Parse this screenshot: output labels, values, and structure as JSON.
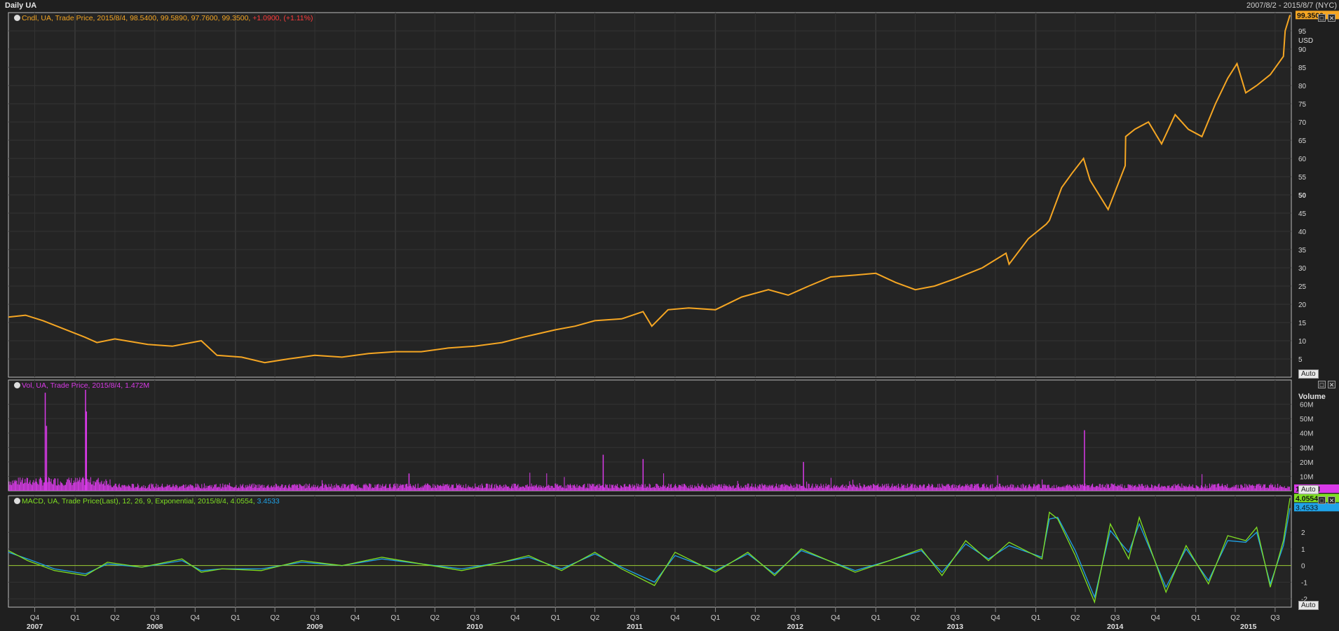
{
  "header": {
    "title": "Daily UA",
    "range": "2007/8/2 - 2015/8/7 (NYC)"
  },
  "price_panel": {
    "legend_prefix": "Cndl, UA, Trade Price, 2015/8/4, 98.5400, 99.5890, 97.7600, 99.3500,",
    "legend_change": "+1.0900, (+1.11%)",
    "currency": "USD",
    "last_value": "99.3500",
    "auto_label": "Auto",
    "color": "#f5a623",
    "change_color": "#ff3b3b"
  },
  "volume_panel": {
    "legend": "Vol, UA, Trade Price, 2015/8/4, 1.472M",
    "axis_title": "Volume",
    "last_value": "1.472M",
    "auto_label": "Auto",
    "color": "#d93ae8"
  },
  "macd_panel": {
    "legend_prefix": "MACD, UA, Trade Price(Last), 12, 26, 9, Exponential, 2015/8/4, 4.0554,",
    "legend_signal": "3.4533",
    "macd_last": "4.0554",
    "signal_last": "3.4533",
    "auto_label": "Auto",
    "macd_color": "#7fe022",
    "signal_color": "#1fa3e8"
  },
  "chart_data": [
    {
      "type": "line",
      "ylim": [
        0,
        100
      ],
      "y_ticks": [
        5,
        10,
        15,
        20,
        25,
        30,
        35,
        40,
        45,
        50,
        55,
        60,
        65,
        70,
        75,
        80,
        85,
        90,
        95
      ],
      "x": [
        "2007-08-02",
        "2007-09-10",
        "2007-10-20",
        "2007-12-01",
        "2008-01-23",
        "2008-02-20",
        "2008-04-01",
        "2008-06-15",
        "2008-08-10",
        "2008-10-15",
        "2008-11-20",
        "2009-01-15",
        "2009-03-09",
        "2009-05-01",
        "2009-07-01",
        "2009-09-01",
        "2009-11-01",
        "2010-01-01",
        "2010-03-01",
        "2010-05-01",
        "2010-07-01",
        "2010-09-01",
        "2010-10-20",
        "2011-01-01",
        "2011-02-15",
        "2011-04-01",
        "2011-06-01",
        "2011-07-20",
        "2011-08-09",
        "2011-09-15",
        "2011-11-01",
        "2012-01-01",
        "2012-03-01",
        "2012-05-01",
        "2012-06-15",
        "2012-08-01",
        "2012-09-20",
        "2012-11-15",
        "2013-01-01",
        "2013-02-15",
        "2013-04-01",
        "2013-05-15",
        "2013-07-01",
        "2013-09-01",
        "2013-10-25",
        "2013-11-01",
        "2013-12-15",
        "2014-01-25",
        "2014-02-01",
        "2014-03-01",
        "2014-03-25",
        "2014-04-20",
        "2014-05-05",
        "2014-06-15",
        "2014-07-24",
        "2014-07-25",
        "2014-08-15",
        "2014-09-15",
        "2014-10-15",
        "2014-11-15",
        "2014-12-15",
        "2015-01-15",
        "2015-02-15",
        "2015-03-15",
        "2015-04-05",
        "2015-04-25",
        "2015-05-20",
        "2015-06-20",
        "2015-07-20",
        "2015-07-24",
        "2015-08-04"
      ],
      "series": [
        {
          "values": [
            16.5,
            17,
            15.5,
            13.5,
            11,
            9.5,
            10.5,
            9,
            8.5,
            10,
            6,
            5.5,
            4,
            5,
            6,
            5.5,
            6.5,
            7,
            7,
            8,
            8.5,
            9.5,
            11,
            13,
            14,
            15.5,
            16,
            18,
            14,
            18.5,
            19,
            18.5,
            22,
            24,
            22.5,
            25,
            27.5,
            28,
            28.5,
            26,
            24,
            25,
            27,
            30,
            34,
            31,
            38,
            42,
            43,
            52,
            56,
            60,
            54,
            46,
            58,
            66,
            68,
            70,
            64,
            72,
            68,
            66,
            75,
            82,
            86,
            78,
            80,
            83,
            88,
            95,
            99.35
          ]
        }
      ]
    },
    {
      "type": "bar",
      "ylim": [
        0,
        70
      ],
      "y_ticks_labels": [
        "10M",
        "20M",
        "30M",
        "40M",
        "50M",
        "60M"
      ],
      "y_ticks": [
        10,
        20,
        30,
        40,
        50,
        60
      ],
      "unit": "M",
      "x": [
        "2007-10-25",
        "2007-10-28",
        "2008-01-25",
        "2008-01-27",
        "2010-02-01",
        "2011-04-20",
        "2014-04-22",
        "2011-07-20",
        "2012-07-20"
      ],
      "values": [
        68,
        45,
        70,
        55,
        12,
        25,
        42,
        22,
        20
      ],
      "last_value": 1.472
    },
    {
      "type": "line",
      "ylim": [
        -2.5,
        4.2
      ],
      "y_ticks": [
        -2,
        -1,
        0,
        1,
        2
      ],
      "x": [
        "2007-08-02",
        "2007-09-15",
        "2007-11-15",
        "2008-01-25",
        "2008-03-15",
        "2008-06-01",
        "2008-09-01",
        "2008-10-15",
        "2008-12-01",
        "2009-03-01",
        "2009-06-01",
        "2009-09-01",
        "2009-12-01",
        "2010-03-01",
        "2010-06-01",
        "2010-09-01",
        "2010-11-01",
        "2011-01-15",
        "2011-04-01",
        "2011-06-01",
        "2011-08-15",
        "2011-10-01",
        "2012-01-01",
        "2012-03-15",
        "2012-05-15",
        "2012-07-15",
        "2012-09-15",
        "2012-11-15",
        "2013-02-01",
        "2013-04-15",
        "2013-06-01",
        "2013-07-25",
        "2013-09-15",
        "2013-11-01",
        "2014-01-15",
        "2014-02-01",
        "2014-02-20",
        "2014-04-01",
        "2014-05-15",
        "2014-06-20",
        "2014-08-01",
        "2014-08-25",
        "2014-10-25",
        "2014-12-10",
        "2015-01-30",
        "2015-03-15",
        "2015-04-25",
        "2015-05-20",
        "2015-06-20",
        "2015-07-20",
        "2015-08-04"
      ],
      "series": [
        {
          "name": "MACD",
          "values": [
            0.9,
            0.3,
            -0.3,
            -0.6,
            0.2,
            -0.1,
            0.4,
            -0.4,
            -0.2,
            -0.3,
            0.3,
            0,
            0.5,
            0.1,
            -0.3,
            0.2,
            0.6,
            -0.3,
            0.8,
            -0.2,
            -1.2,
            0.8,
            -0.4,
            0.8,
            -0.6,
            1,
            0.3,
            -0.4,
            0.3,
            1,
            -0.6,
            1.5,
            0.3,
            1.4,
            0.4,
            3.2,
            2.8,
            0.6,
            -2.2,
            2.5,
            0.4,
            2.9,
            -1.6,
            1.2,
            -1.1,
            1.8,
            1.5,
            2.3,
            -1.3,
            1.5,
            4.06
          ]
        },
        {
          "name": "Signal",
          "values": [
            0.8,
            0.4,
            -0.2,
            -0.5,
            0.1,
            -0.1,
            0.3,
            -0.3,
            -0.2,
            -0.2,
            0.2,
            0,
            0.4,
            0.1,
            -0.2,
            0.2,
            0.5,
            -0.2,
            0.7,
            -0.1,
            -1,
            0.6,
            -0.3,
            0.7,
            -0.5,
            0.9,
            0.3,
            -0.3,
            0.3,
            0.9,
            -0.4,
            1.3,
            0.4,
            1.2,
            0.5,
            2.8,
            2.9,
            0.9,
            -1.9,
            2.1,
            0.8,
            2.5,
            -1.3,
            1,
            -0.9,
            1.5,
            1.4,
            2,
            -1.1,
            1.2,
            3.45
          ]
        }
      ]
    }
  ],
  "x_axis": {
    "quarters": [
      {
        "label": "Q4",
        "date": "2007-10-01"
      },
      {
        "label": "Q1",
        "date": "2008-01-01"
      },
      {
        "label": "Q2",
        "date": "2008-04-01"
      },
      {
        "label": "Q3",
        "date": "2008-07-01"
      },
      {
        "label": "Q4",
        "date": "2008-10-01"
      },
      {
        "label": "Q1",
        "date": "2009-01-01"
      },
      {
        "label": "Q2",
        "date": "2009-04-01"
      },
      {
        "label": "Q3",
        "date": "2009-07-01"
      },
      {
        "label": "Q4",
        "date": "2009-10-01"
      },
      {
        "label": "Q1",
        "date": "2010-01-01"
      },
      {
        "label": "Q2",
        "date": "2010-04-01"
      },
      {
        "label": "Q3",
        "date": "2010-07-01"
      },
      {
        "label": "Q4",
        "date": "2010-10-01"
      },
      {
        "label": "Q1",
        "date": "2011-01-01"
      },
      {
        "label": "Q2",
        "date": "2011-04-01"
      },
      {
        "label": "Q3",
        "date": "2011-07-01"
      },
      {
        "label": "Q4",
        "date": "2011-10-01"
      },
      {
        "label": "Q1",
        "date": "2012-01-01"
      },
      {
        "label": "Q2",
        "date": "2012-04-01"
      },
      {
        "label": "Q3",
        "date": "2012-07-01"
      },
      {
        "label": "Q4",
        "date": "2012-10-01"
      },
      {
        "label": "Q1",
        "date": "2013-01-01"
      },
      {
        "label": "Q2",
        "date": "2013-04-01"
      },
      {
        "label": "Q3",
        "date": "2013-07-01"
      },
      {
        "label": "Q4",
        "date": "2013-10-01"
      },
      {
        "label": "Q1",
        "date": "2014-01-01"
      },
      {
        "label": "Q2",
        "date": "2014-04-01"
      },
      {
        "label": "Q3",
        "date": "2014-07-01"
      },
      {
        "label": "Q4",
        "date": "2014-10-01"
      },
      {
        "label": "Q1",
        "date": "2015-01-01"
      },
      {
        "label": "Q2",
        "date": "2015-04-01"
      },
      {
        "label": "Q3",
        "date": "2015-07-01"
      }
    ],
    "years": [
      {
        "label": "2007",
        "date": "2007-10-01"
      },
      {
        "label": "2008",
        "date": "2008-07-01"
      },
      {
        "label": "2009",
        "date": "2009-07-01"
      },
      {
        "label": "2010",
        "date": "2010-07-01"
      },
      {
        "label": "2011",
        "date": "2011-07-01"
      },
      {
        "label": "2012",
        "date": "2012-07-01"
      },
      {
        "label": "2013",
        "date": "2013-07-01"
      },
      {
        "label": "2014",
        "date": "2014-07-01"
      },
      {
        "label": "2015",
        "date": "2015-05-01"
      }
    ]
  }
}
